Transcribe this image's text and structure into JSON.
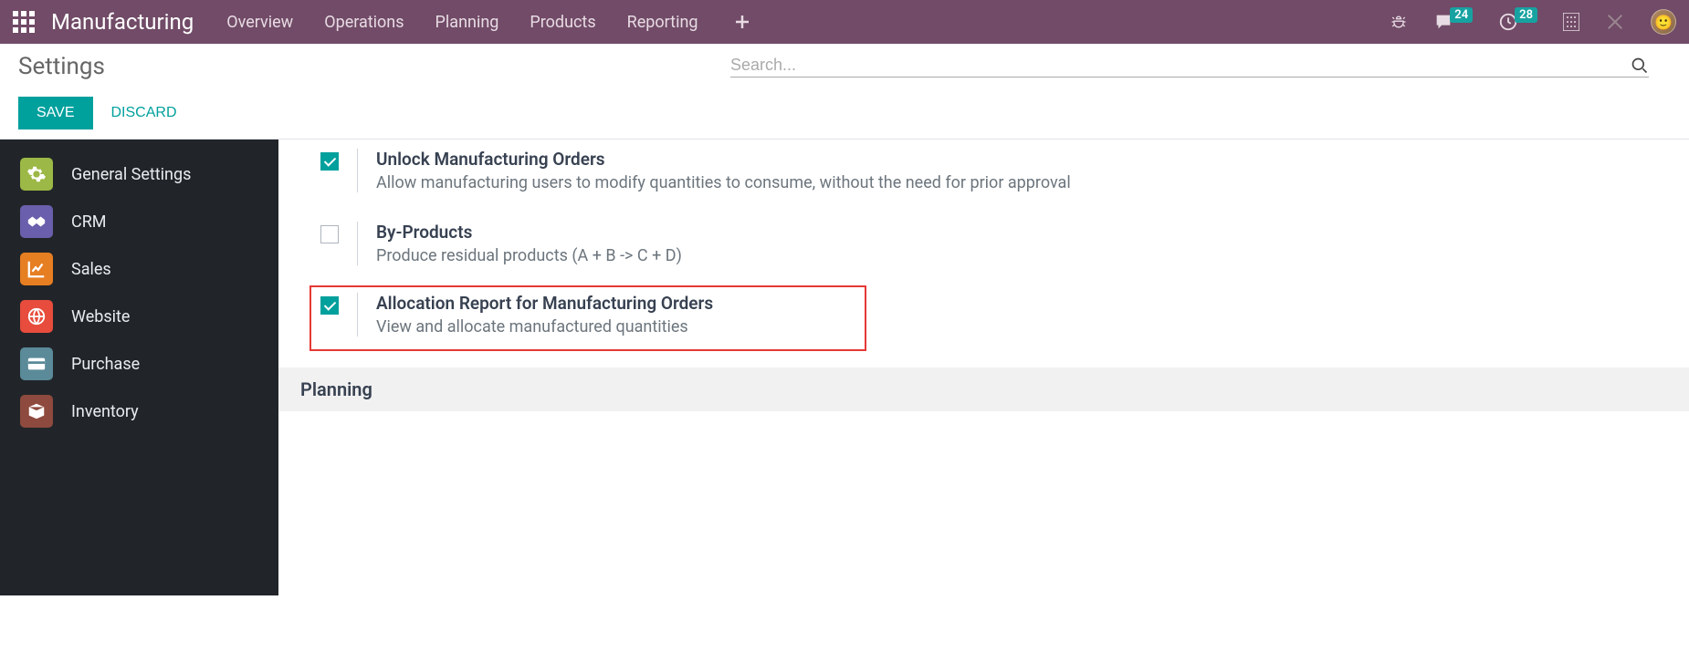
{
  "nav": {
    "brand": "Manufacturing",
    "items": [
      "Overview",
      "Operations",
      "Planning",
      "Products",
      "Reporting"
    ],
    "chat_badge": "24",
    "clock_badge": "28"
  },
  "control": {
    "breadcrumb": "Settings",
    "search_placeholder": "Search...",
    "save": "SAVE",
    "discard": "DISCARD"
  },
  "sidebar": {
    "items": [
      {
        "label": "General Settings"
      },
      {
        "label": "CRM"
      },
      {
        "label": "Sales"
      },
      {
        "label": "Website"
      },
      {
        "label": "Purchase"
      },
      {
        "label": "Inventory"
      }
    ]
  },
  "settings": {
    "unlock": {
      "checked": true,
      "title": "Unlock Manufacturing Orders",
      "desc": "Allow manufacturing users to modify quantities to consume, without the need for prior approval"
    },
    "byproducts": {
      "checked": false,
      "title": "By-Products",
      "desc": "Produce residual products (A + B -> C + D)"
    },
    "allocation": {
      "checked": true,
      "title": "Allocation Report for Manufacturing Orders",
      "desc": "View and allocate manufactured quantities"
    },
    "planning_section": "Planning"
  }
}
